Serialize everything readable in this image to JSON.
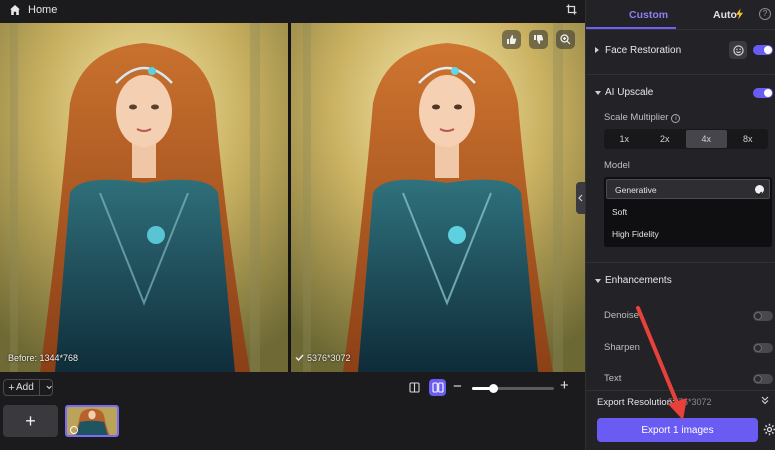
{
  "header": {
    "home_label": "Home"
  },
  "preview": {
    "before_caption": "Before: 1344*768",
    "after_caption": "5376*3072"
  },
  "toolbar": {
    "add_label": "Add",
    "add_tile_label": "+"
  },
  "zoom": {
    "level_fraction": 0.25
  },
  "panel": {
    "tabs": [
      {
        "label": "Custom",
        "active": true
      },
      {
        "label": "Auto",
        "active": false
      }
    ],
    "face_restoration": {
      "title": "Face Restoration",
      "enabled": true
    },
    "ai_upscale": {
      "title": "AI Upscale",
      "enabled": true,
      "scale_label": "Scale Multiplier",
      "scale_options": [
        "1x",
        "2x",
        "4x",
        "8x"
      ],
      "scale_selected": "4x",
      "model_label": "Model",
      "models": [
        "Generative",
        "Soft",
        "High Fidelity"
      ],
      "model_selected": "Generative"
    },
    "enhancements": {
      "title": "Enhancements",
      "items": [
        {
          "label": "Denoise",
          "enabled": false
        },
        {
          "label": "Sharpen",
          "enabled": false
        },
        {
          "label": "Text",
          "enabled": false
        }
      ]
    },
    "export_resolution_label": "Export Resolution:",
    "export_resolution_value": "5376*3072",
    "export_button_label": "Export 1 images"
  },
  "colors": {
    "accent": "#6a5cf3",
    "annotation": "#e8413a"
  },
  "icons": [
    "home-icon",
    "crop-icon",
    "thumbs-up-icon",
    "thumbs-down-icon",
    "zoom-icon",
    "smile-icon",
    "info-icon",
    "bolt-icon",
    "help-icon",
    "check-icon",
    "double-chevron-icon",
    "gear-icon"
  ]
}
